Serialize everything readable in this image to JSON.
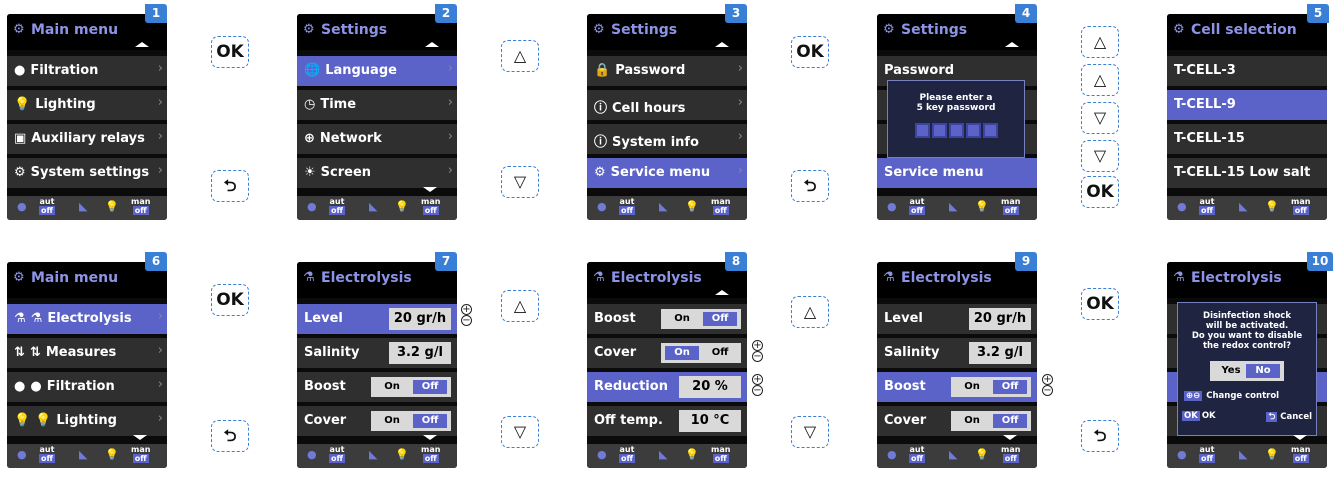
{
  "screens": [
    {
      "num": "1",
      "title": "Main menu",
      "title_icon": "gear-icon",
      "rows": [
        "Filtration",
        "Lighting",
        "Auxiliary relays",
        "System settings"
      ],
      "row_icons": [
        "filter-icon",
        "bulb-icon",
        "relay-icon",
        "gear-icon"
      ]
    },
    {
      "num": "2",
      "title": "Settings",
      "rows": [
        "Language",
        "Time",
        "Network",
        "Screen"
      ]
    },
    {
      "num": "3",
      "title": "Settings",
      "rows": [
        "Password",
        "Cell hours",
        "System info",
        "Service menu"
      ]
    },
    {
      "num": "4",
      "title": "Settings",
      "rows": [
        "Password",
        "Service menu"
      ],
      "dialog": {
        "line1": "Please enter a",
        "line2": "5 key password"
      }
    },
    {
      "num": "5",
      "title": "Cell selection",
      "rows": [
        "T-CELL-3",
        "T-CELL-9",
        "T-CELL-15",
        "T-CELL-15 Low salt"
      ]
    },
    {
      "num": "6",
      "title": "Main menu",
      "rows": [
        "Electrolysis",
        "Measures",
        "Filtration",
        "Lighting"
      ]
    },
    {
      "num": "7",
      "title": "Electrolysis",
      "rows": [
        "Level",
        "Salinity",
        "Boost",
        "Cover"
      ],
      "values": [
        "20 gr/h",
        "3.2 g/l"
      ]
    },
    {
      "num": "8",
      "title": "Electrolysis",
      "rows": [
        "Boost",
        "Cover",
        "Reduction",
        "Off temp."
      ],
      "values": [
        "20 %",
        "10 °C"
      ]
    },
    {
      "num": "9",
      "title": "Electrolysis",
      "rows": [
        "Level",
        "Salinity",
        "Boost",
        "Cover"
      ],
      "values": [
        "20 gr/h",
        "3.2 g/l"
      ]
    },
    {
      "num": "10",
      "title": "Electrolysis",
      "dialog": {
        "text1": "Disinfection shock",
        "text2": "will be activated.",
        "text3": "Do you want to disable",
        "text4": "the redox control?",
        "yes": "Yes",
        "no": "No",
        "change": "Change control",
        "ok": "OK",
        "cancel": "Cancel"
      }
    }
  ],
  "toggle": {
    "on": "On",
    "off": "Off"
  },
  "footer": {
    "aut": "aut",
    "man": "man",
    "off": "off"
  },
  "buttons": {
    "ok": "OK",
    "up": "△",
    "down": "▽",
    "back": "⮌"
  },
  "pm": {
    "plus": "+",
    "minus": "−"
  },
  "colors": {
    "accent": "#5b63c8",
    "badge": "#3a7fd6",
    "title": "#8d93e6"
  }
}
